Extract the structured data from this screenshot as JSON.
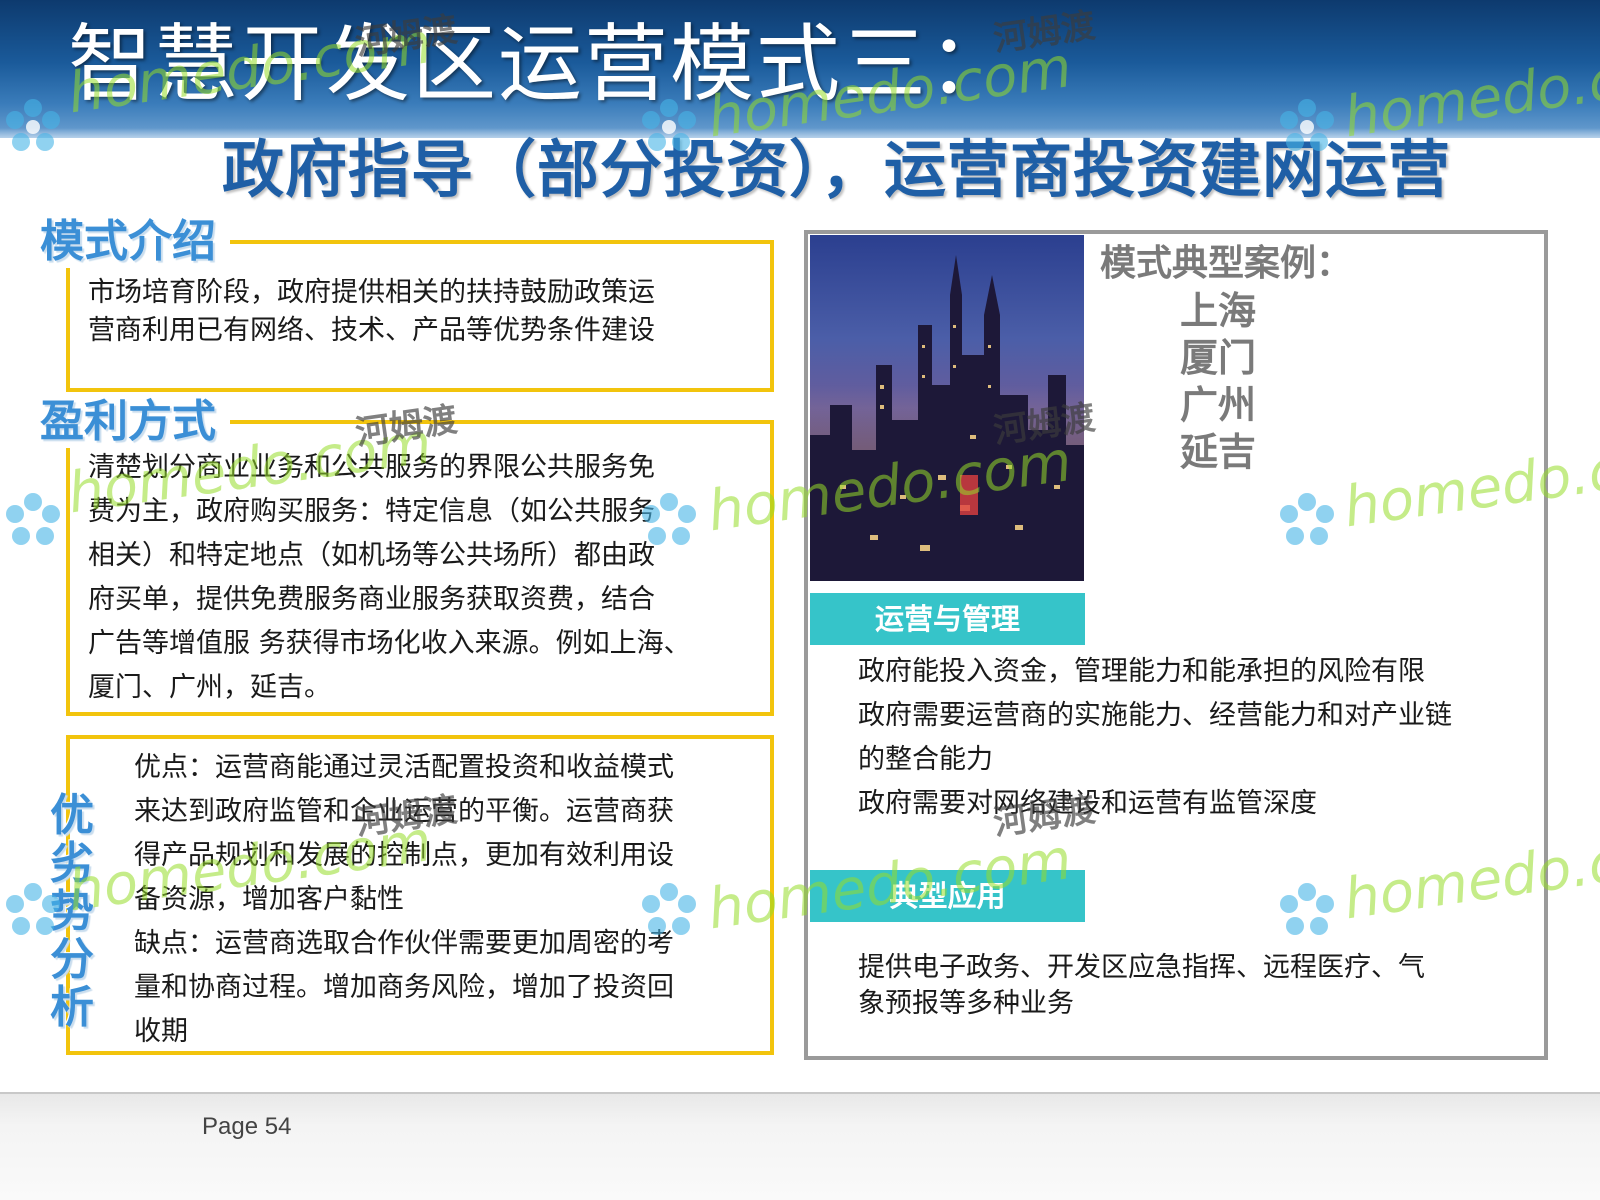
{
  "header": {
    "title": "智慧开发区运营模式三：",
    "subtitle": "政府指导（部分投资），运营商投资建网运营"
  },
  "intro": {
    "label": "模式介绍",
    "lines": [
      "市场培育阶段，政府提供相关的扶持鼓励政策运",
      "营商利用已有网络、技术、产品等优势条件建设"
    ]
  },
  "profit": {
    "label": "盈利方式",
    "lines": [
      "清楚划分商业业务和公共服务的界限公共服务免",
      "费为主，政府购买服务：特定信息（如公共服务",
      "相关）和特定地点（如机场等公共场所）都由政",
      "府买单，提供免费服务商业服务获取资费，结合",
      "广告等增值服 务获得市场化收入来源。例如上海、",
      "厦门、广州，延吉。"
    ]
  },
  "analysis": {
    "label_chars": [
      "优",
      "劣",
      "势",
      "分",
      "析"
    ],
    "lines": [
      "优点：运营商能通过灵活配置投资和收益模式",
      "来达到政府监管和企业运营的平衡。运营商获",
      "得产品规划和发展的控制点，更加有效利用设",
      "备资源，增加客户黏性",
      "缺点：运营商选取合作伙伴需要更加周密的考",
      "量和协商过程。增加商务风险，增加了投资回",
      "收期"
    ]
  },
  "cases": {
    "title": "模式典型案例：",
    "items": [
      "上海",
      "厦门",
      "广州",
      "延吉"
    ]
  },
  "operations": {
    "label": "运营与管理",
    "lines": [
      "政府能投入资金，管理能力和能承担的风险有限",
      "政府需要运营商的实施能力、经营能力和对产业链",
      "的整合能力",
      "政府需要对网络建设和运营有监管深度"
    ]
  },
  "applications": {
    "label": "典型应用",
    "lines": [
      "提供电子政务、开发区应急指挥、远程医疗、气",
      "象预报等多种业务"
    ]
  },
  "footer": {
    "page": "Page 54"
  },
  "watermark": {
    "latin": "homedo.com",
    "latin_short": "homedo.co",
    "cn": "河姆渡"
  },
  "colors": {
    "header_blue": "#1a5a9a",
    "subtitle_blue": "#1f5fa6",
    "label_blue": "#3b8fd6",
    "box_yellow": "#f2c40d",
    "teal": "#36c4c9",
    "panel_gray": "#9a9a9a",
    "watermark_green": "#96dc28"
  },
  "icons": {
    "watermark_logo": "flower-logo-icon"
  }
}
